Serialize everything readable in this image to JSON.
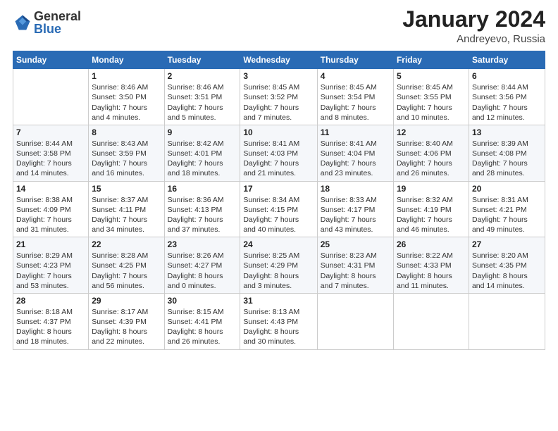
{
  "header": {
    "logo_general": "General",
    "logo_blue": "Blue",
    "month_title": "January 2024",
    "location": "Andreyevo, Russia"
  },
  "weekdays": [
    "Sunday",
    "Monday",
    "Tuesday",
    "Wednesday",
    "Thursday",
    "Friday",
    "Saturday"
  ],
  "weeks": [
    [
      {
        "day": "",
        "info": ""
      },
      {
        "day": "1",
        "info": "Sunrise: 8:46 AM\nSunset: 3:50 PM\nDaylight: 7 hours\nand 4 minutes."
      },
      {
        "day": "2",
        "info": "Sunrise: 8:46 AM\nSunset: 3:51 PM\nDaylight: 7 hours\nand 5 minutes."
      },
      {
        "day": "3",
        "info": "Sunrise: 8:45 AM\nSunset: 3:52 PM\nDaylight: 7 hours\nand 7 minutes."
      },
      {
        "day": "4",
        "info": "Sunrise: 8:45 AM\nSunset: 3:54 PM\nDaylight: 7 hours\nand 8 minutes."
      },
      {
        "day": "5",
        "info": "Sunrise: 8:45 AM\nSunset: 3:55 PM\nDaylight: 7 hours\nand 10 minutes."
      },
      {
        "day": "6",
        "info": "Sunrise: 8:44 AM\nSunset: 3:56 PM\nDaylight: 7 hours\nand 12 minutes."
      }
    ],
    [
      {
        "day": "7",
        "info": "Sunrise: 8:44 AM\nSunset: 3:58 PM\nDaylight: 7 hours\nand 14 minutes."
      },
      {
        "day": "8",
        "info": "Sunrise: 8:43 AM\nSunset: 3:59 PM\nDaylight: 7 hours\nand 16 minutes."
      },
      {
        "day": "9",
        "info": "Sunrise: 8:42 AM\nSunset: 4:01 PM\nDaylight: 7 hours\nand 18 minutes."
      },
      {
        "day": "10",
        "info": "Sunrise: 8:41 AM\nSunset: 4:03 PM\nDaylight: 7 hours\nand 21 minutes."
      },
      {
        "day": "11",
        "info": "Sunrise: 8:41 AM\nSunset: 4:04 PM\nDaylight: 7 hours\nand 23 minutes."
      },
      {
        "day": "12",
        "info": "Sunrise: 8:40 AM\nSunset: 4:06 PM\nDaylight: 7 hours\nand 26 minutes."
      },
      {
        "day": "13",
        "info": "Sunrise: 8:39 AM\nSunset: 4:08 PM\nDaylight: 7 hours\nand 28 minutes."
      }
    ],
    [
      {
        "day": "14",
        "info": "Sunrise: 8:38 AM\nSunset: 4:09 PM\nDaylight: 7 hours\nand 31 minutes."
      },
      {
        "day": "15",
        "info": "Sunrise: 8:37 AM\nSunset: 4:11 PM\nDaylight: 7 hours\nand 34 minutes."
      },
      {
        "day": "16",
        "info": "Sunrise: 8:36 AM\nSunset: 4:13 PM\nDaylight: 7 hours\nand 37 minutes."
      },
      {
        "day": "17",
        "info": "Sunrise: 8:34 AM\nSunset: 4:15 PM\nDaylight: 7 hours\nand 40 minutes."
      },
      {
        "day": "18",
        "info": "Sunrise: 8:33 AM\nSunset: 4:17 PM\nDaylight: 7 hours\nand 43 minutes."
      },
      {
        "day": "19",
        "info": "Sunrise: 8:32 AM\nSunset: 4:19 PM\nDaylight: 7 hours\nand 46 minutes."
      },
      {
        "day": "20",
        "info": "Sunrise: 8:31 AM\nSunset: 4:21 PM\nDaylight: 7 hours\nand 49 minutes."
      }
    ],
    [
      {
        "day": "21",
        "info": "Sunrise: 8:29 AM\nSunset: 4:23 PM\nDaylight: 7 hours\nand 53 minutes."
      },
      {
        "day": "22",
        "info": "Sunrise: 8:28 AM\nSunset: 4:25 PM\nDaylight: 7 hours\nand 56 minutes."
      },
      {
        "day": "23",
        "info": "Sunrise: 8:26 AM\nSunset: 4:27 PM\nDaylight: 8 hours\nand 0 minutes."
      },
      {
        "day": "24",
        "info": "Sunrise: 8:25 AM\nSunset: 4:29 PM\nDaylight: 8 hours\nand 3 minutes."
      },
      {
        "day": "25",
        "info": "Sunrise: 8:23 AM\nSunset: 4:31 PM\nDaylight: 8 hours\nand 7 minutes."
      },
      {
        "day": "26",
        "info": "Sunrise: 8:22 AM\nSunset: 4:33 PM\nDaylight: 8 hours\nand 11 minutes."
      },
      {
        "day": "27",
        "info": "Sunrise: 8:20 AM\nSunset: 4:35 PM\nDaylight: 8 hours\nand 14 minutes."
      }
    ],
    [
      {
        "day": "28",
        "info": "Sunrise: 8:18 AM\nSunset: 4:37 PM\nDaylight: 8 hours\nand 18 minutes."
      },
      {
        "day": "29",
        "info": "Sunrise: 8:17 AM\nSunset: 4:39 PM\nDaylight: 8 hours\nand 22 minutes."
      },
      {
        "day": "30",
        "info": "Sunrise: 8:15 AM\nSunset: 4:41 PM\nDaylight: 8 hours\nand 26 minutes."
      },
      {
        "day": "31",
        "info": "Sunrise: 8:13 AM\nSunset: 4:43 PM\nDaylight: 8 hours\nand 30 minutes."
      },
      {
        "day": "",
        "info": ""
      },
      {
        "day": "",
        "info": ""
      },
      {
        "day": "",
        "info": ""
      }
    ]
  ]
}
